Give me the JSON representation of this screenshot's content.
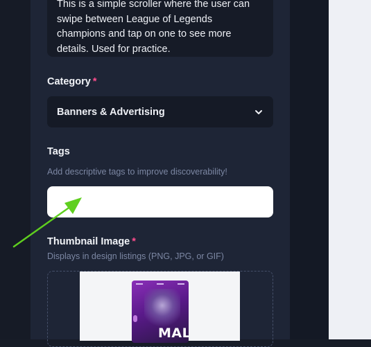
{
  "description": {
    "lines": [
      "This is a simple scroller where the user can",
      "swipe between League of Legends",
      "champions and tap on one to see more",
      "details. Used for practice."
    ]
  },
  "category": {
    "label": "Category",
    "required_mark": "*",
    "selected": "Banners & Advertising",
    "icon": "chevron-down-icon"
  },
  "tags": {
    "label": "Tags",
    "hint": "Add descriptive tags to improve discoverability!",
    "value": ""
  },
  "thumbnail": {
    "label": "Thumbnail Image",
    "required_mark": "*",
    "hint": "Displays in design listings (PNG, JPG, or GIF)",
    "preview_title": "MAL"
  },
  "colors": {
    "accent_required": "#ff4d8d",
    "annotation_arrow": "#5fcf1f"
  }
}
